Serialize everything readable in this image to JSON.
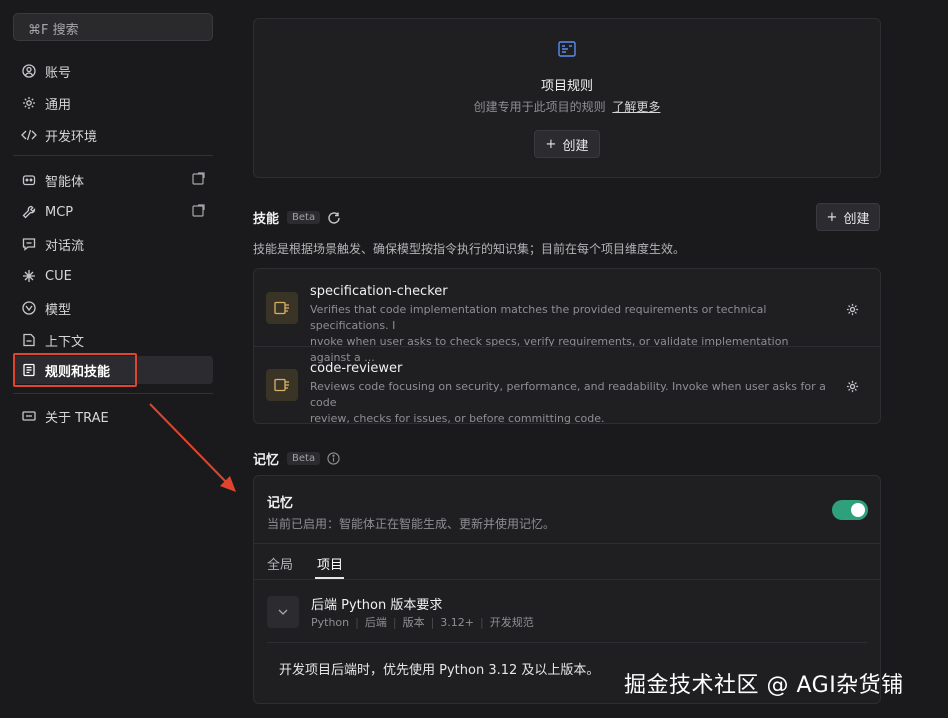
{
  "sidebar": {
    "search_placeholder": "⌘F 搜索",
    "items": [
      {
        "label": "账号"
      },
      {
        "label": "通用"
      },
      {
        "label": "开发环境"
      },
      {
        "label": "智能体"
      },
      {
        "label": "MCP"
      },
      {
        "label": "对话流"
      },
      {
        "label": "CUE"
      },
      {
        "label": "模型"
      },
      {
        "label": "上下文"
      },
      {
        "label": "规则和技能"
      },
      {
        "label": "关于 TRAE"
      }
    ]
  },
  "rules": {
    "card_title": "项目规则",
    "card_desc": "创建专用于此项目的规则",
    "learn_more": "了解更多",
    "create_label": "创建"
  },
  "skills": {
    "title": "技能",
    "badge": "Beta",
    "create_label": "创建",
    "description": "技能是根据场景触发、确保模型按指令执行的知识集；目前在每个项目维度生效。",
    "items": [
      {
        "name": "specification-checker",
        "desc_line1": "Verifies that code implementation matches the provided requirements or technical specifications. I",
        "desc_line2": "nvoke when user asks to check specs, verify requirements, or validate implementation against a ..."
      },
      {
        "name": "code-reviewer",
        "desc_line1": "Reviews code focusing on security, performance, and readability. Invoke when user asks for a code",
        "desc_line2": "review, checks for issues, or before committing code."
      }
    ]
  },
  "memory": {
    "title": "记忆",
    "badge": "Beta",
    "panel_title": "记忆",
    "panel_desc": "当前已启用：智能体正在智能生成、更新并使用记忆。",
    "toggle_on": true,
    "tabs": [
      {
        "label": "全局"
      },
      {
        "label": "项目"
      }
    ],
    "entry": {
      "title": "后端 Python 版本要求",
      "tags": [
        "Python",
        "后端",
        "版本",
        "3.12+",
        "开发规范"
      ],
      "content": "开发项目后端时，优先使用 Python 3.12 及以上版本。"
    }
  },
  "watermark": "掘金技术社区 @ AGI杂货铺",
  "colors": {
    "background": "#1a1a1c",
    "panel": "#1f1f22",
    "toggle_on": "#2fa17a",
    "annotation_red": "#e0442e"
  }
}
